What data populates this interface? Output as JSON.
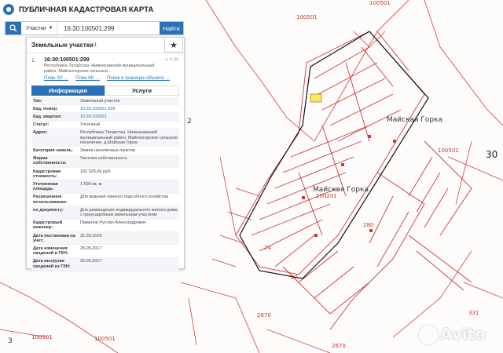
{
  "app": {
    "title": "ПУБЛИЧНАЯ КАДАСТРОВАЯ КАРТА"
  },
  "search": {
    "type_label": "Участки",
    "value": "16:30:100501:299",
    "find_label": "Найти"
  },
  "panel": {
    "title": "Земельные участки",
    "count": "1",
    "item": {
      "number": "1.",
      "cad_number": "16:30:100501:299",
      "address": "Республика Татарстан, Нижнекамский муниципальный район, Майскогорское сельское...",
      "links": [
        "План ЗУ →",
        "План КК →",
        "Поиск в границах объекта →"
      ]
    },
    "tabs": {
      "info": "Информация",
      "services": "Услуги"
    },
    "rows": [
      {
        "label": "Тип:",
        "value": "Земельный участок"
      },
      {
        "label": "Кад. номер:",
        "value": "16:30:100501:299"
      },
      {
        "label": "Кад. квартал:",
        "value": "16:30:100501"
      },
      {
        "label": "Статус:",
        "value": "Учтенный"
      },
      {
        "label": "Адрес:",
        "value": "Республика Татарстан, Нижнекамский муниципальный район, Майскогорское сельское поселение, д.Майская Горка"
      },
      {
        "label": "Категория земель:",
        "value": "Земли населённых пунктов"
      },
      {
        "label": "Форма собственности:",
        "value": "Частная собственность"
      },
      {
        "label": "Кадастровая стоимость:",
        "value": "102 525,00 руб."
      },
      {
        "label": "Уточненная площадь:",
        "value": "1 500 кв. м"
      },
      {
        "label": "Разрешенное использование:",
        "value": "Для ведения личного подсобного хозяйства"
      },
      {
        "label": "по документу:",
        "value": "Для размещения индивидуального жилого дома с приусадебным земельным участком"
      },
      {
        "label": "Кадастровый инженер:",
        "value": "Пименов Руслан Александрович"
      },
      {
        "label": "Дата постановки на учет:",
        "value": "31.03.2016"
      },
      {
        "label": "Дата изменения сведений в ГКН:",
        "value": "25.05.2017"
      },
      {
        "label": "Дата выгрузки сведений из ГКН:",
        "value": "25.05.2017"
      }
    ]
  },
  "map": {
    "labels": [
      "100501",
      "100501",
      "100501",
      "100501",
      "Майская Горка",
      "Майская Горка",
      "100201",
      "30",
      "2",
      "2670",
      "2670",
      "3",
      "331",
      "280",
      "24",
      "47",
      "100501"
    ]
  },
  "watermark": "Avito"
}
